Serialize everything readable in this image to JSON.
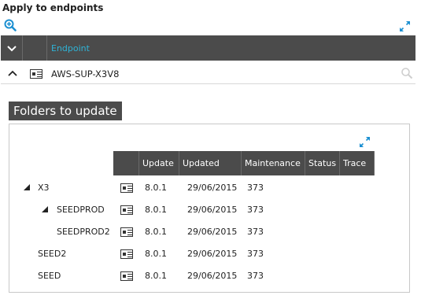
{
  "endpoints_section": {
    "title": "Apply to endpoints",
    "zoom_icon": "zoom-in-icon",
    "expand_icon": "expand-icon",
    "header": {
      "toggle_icon": "chevron-down-icon",
      "endpoint_label": "Endpoint"
    },
    "rows": [
      {
        "name": "AWS-SUP-X3V8",
        "collapse_icon": "chevron-up-icon",
        "type_icon": "card-icon",
        "search_icon": "search-icon"
      }
    ]
  },
  "folders_section": {
    "title": "Folders to update",
    "expand_icon": "expand-icon",
    "columns": {
      "update": "Update",
      "updated": "Updated",
      "maintenance": "Maintenance",
      "status": "Status",
      "trace": "Trace"
    },
    "rows": [
      {
        "name": "X3",
        "expanded": true,
        "update": "8.0.1",
        "updated": "29/06/2015",
        "maintenance": "373",
        "status": "",
        "trace": ""
      },
      {
        "name": "SEEDPROD",
        "expanded": true,
        "update": "8.0.1",
        "updated": "29/06/2015",
        "maintenance": "373",
        "status": "",
        "trace": ""
      },
      {
        "name": "SEEDPROD2",
        "update": "8.0.1",
        "updated": "29/06/2015",
        "maintenance": "373",
        "status": "",
        "trace": ""
      },
      {
        "name": "SEED2",
        "update": "8.0.1",
        "updated": "29/06/2015",
        "maintenance": "373",
        "status": "",
        "trace": ""
      },
      {
        "name": "SEED",
        "update": "8.0.1",
        "updated": "29/06/2015",
        "maintenance": "373",
        "status": "",
        "trace": ""
      }
    ]
  },
  "colors": {
    "header_bg": "#4b4b4b",
    "accent": "#2fb3d6",
    "icon_blue": "#1b8fd1"
  }
}
